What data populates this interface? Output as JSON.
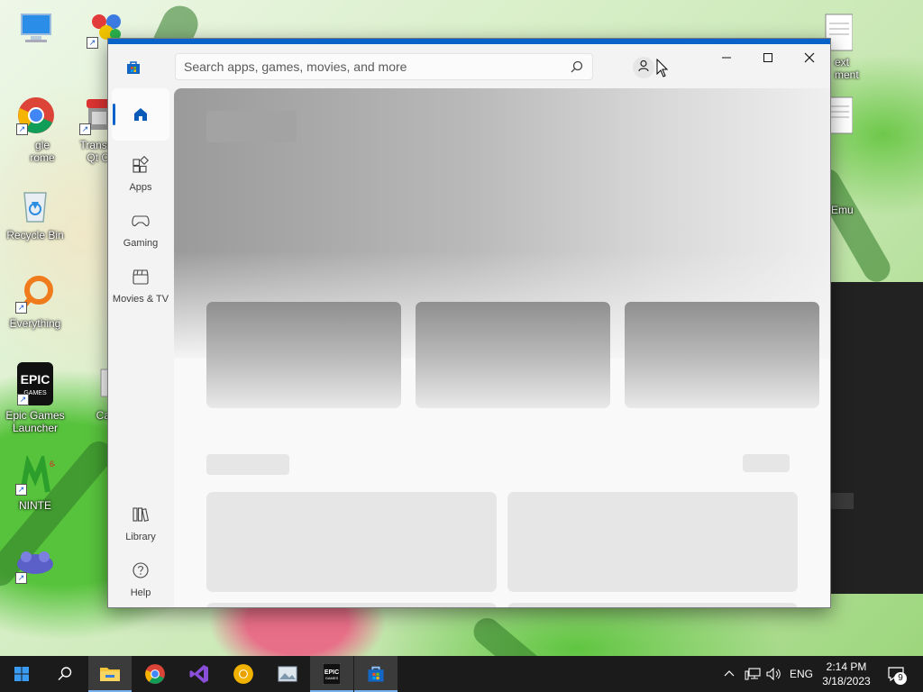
{
  "desktop": {
    "icons": [
      {
        "name": "computer",
        "label": ""
      },
      {
        "name": "emulator",
        "label": ""
      },
      {
        "name": "chrome",
        "label": "Google Chrome",
        "label_visible": "gle\nrome"
      },
      {
        "name": "transmission",
        "label": "Transmi\nQt Cl"
      },
      {
        "name": "recycle-bin",
        "label": "Recycle Bin"
      },
      {
        "name": "everything",
        "label": "Everything"
      },
      {
        "name": "epic-games",
        "label": "Epic Games\nLauncher"
      },
      {
        "name": "calculator",
        "label": "Calcu"
      },
      {
        "name": "nintendo64",
        "label": "NINTE"
      },
      {
        "name": "emulator-2",
        "label": ""
      },
      {
        "name": "text-document",
        "label": "ext\nment"
      },
      {
        "name": "text-document-2",
        "label": ""
      },
      {
        "name": "emu-right",
        "label": "Emu"
      }
    ]
  },
  "window": {
    "search": {
      "placeholder": "Search apps, games, movies, and more"
    },
    "nav": [
      {
        "id": "home",
        "label": ""
      },
      {
        "id": "apps",
        "label": "Apps"
      },
      {
        "id": "gaming",
        "label": "Gaming"
      },
      {
        "id": "movies",
        "label": "Movies & TV"
      },
      {
        "id": "library",
        "label": "Library"
      },
      {
        "id": "help",
        "label": "Help"
      }
    ],
    "controls": {
      "minimize": "—",
      "maximize": "☐",
      "close": "✕"
    },
    "accent": "#0a63c9"
  },
  "taskbar": {
    "apps": [
      "start",
      "search",
      "file-explorer",
      "chrome",
      "visual-studio",
      "chrome-canary",
      "app",
      "epic-games",
      "microsoft-store"
    ],
    "language": "ENG",
    "time": "2:14 PM",
    "date": "3/18/2023",
    "notifications": "9"
  }
}
